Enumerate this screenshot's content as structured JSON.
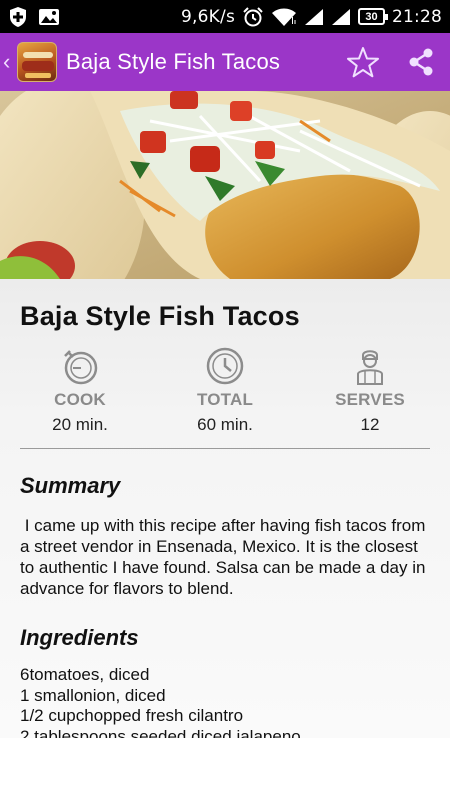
{
  "status_bar": {
    "network_speed": "9,6K/s",
    "battery_level": "30",
    "time": "21:28"
  },
  "app_bar": {
    "title": "Baja Style Fish Tacos",
    "color": "#9b36c8"
  },
  "recipe": {
    "title": "Baja Style Fish Tacos",
    "stats": [
      {
        "label": "COOK",
        "value": "20 min.",
        "icon": "stopwatch-icon"
      },
      {
        "label": "TOTAL",
        "value": "60 min.",
        "icon": "clock-icon"
      },
      {
        "label": "SERVES",
        "value": "12",
        "icon": "person-icon"
      }
    ],
    "summary_heading": "Summary",
    "summary": " I came up with this recipe after having fish tacos from a street vendor in Ensenada, Mexico. It is the closest to authentic I have found. Salsa can be made a day in advance for flavors to blend.",
    "ingredients_heading": "Ingredients",
    "ingredients": [
      "6tomatoes, diced",
      "1 smallonion, diced",
      "1/2 cupchopped fresh cilantro",
      "2 tablespoons seeded diced jalapeno"
    ]
  }
}
